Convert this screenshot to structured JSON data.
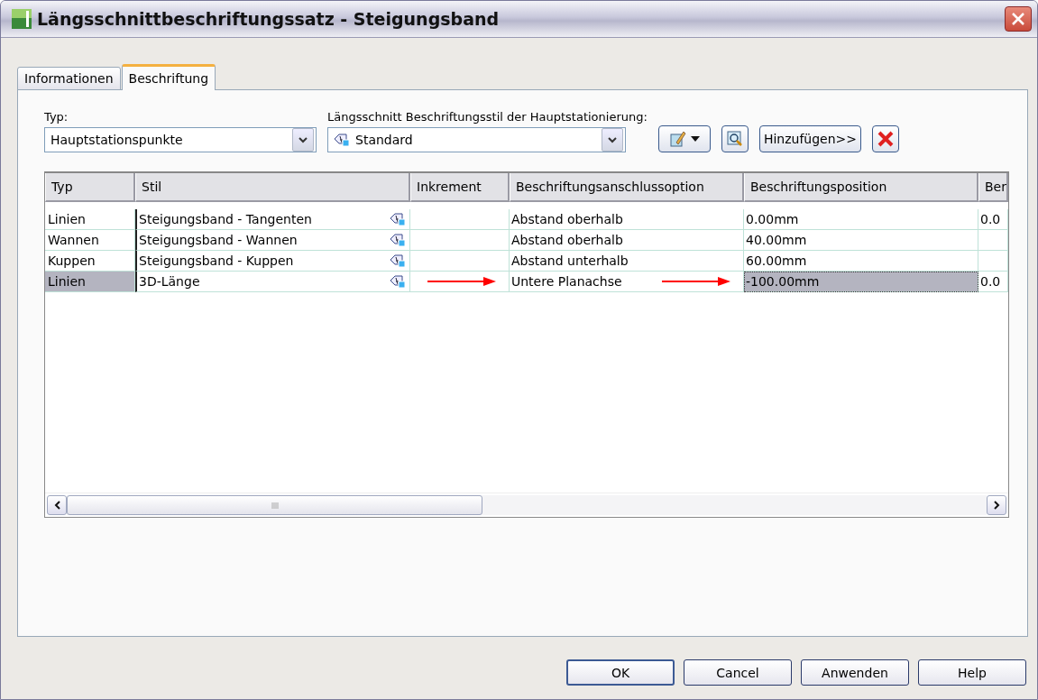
{
  "window": {
    "title": "Längsschnittbeschriftungssatz - Steigungsband"
  },
  "tabs": [
    {
      "label": "Informationen",
      "selected": false
    },
    {
      "label": "Beschriftung",
      "selected": true
    }
  ],
  "type_field": {
    "label": "Typ:",
    "value": "Hauptstationspunkte"
  },
  "style_field": {
    "label": "Längsschnitt Beschriftungsstil der Hauptstationierung:",
    "value": "Standard"
  },
  "add_button": {
    "label": "Hinzufügen>>"
  },
  "table": {
    "columns": [
      {
        "label": "Typ",
        "kind": "text"
      },
      {
        "label": "Stil",
        "kind": "style"
      },
      {
        "label": "Inkrement",
        "kind": "text"
      },
      {
        "label": "Beschriftungsanschlussoption",
        "kind": "text"
      },
      {
        "label": "Beschriftungsposition",
        "kind": "text"
      },
      {
        "label": "Ber",
        "kind": "text"
      }
    ],
    "rows": [
      {
        "selected": false,
        "cells": [
          {
            "text": "Linien",
            "focused": false,
            "arrow": false
          },
          {
            "text": "Steigungsband - Tangenten",
            "focused": false,
            "arrow": false
          },
          {
            "focused": false,
            "arrow": false
          },
          {
            "text": "Abstand oberhalb",
            "focused": false,
            "arrow": false
          },
          {
            "text": "0.00mm",
            "focused": false,
            "arrow": false
          },
          {
            "text": "0.0",
            "focused": false,
            "arrow": false
          }
        ]
      },
      {
        "selected": false,
        "cells": [
          {
            "text": "Wannen",
            "focused": false,
            "arrow": false
          },
          {
            "text": "Steigungsband - Wannen",
            "focused": false,
            "arrow": false
          },
          {
            "focused": false,
            "arrow": false
          },
          {
            "text": "Abstand oberhalb",
            "focused": false,
            "arrow": false
          },
          {
            "text": "40.00mm",
            "focused": false,
            "arrow": false
          },
          {
            "focused": false,
            "arrow": false
          }
        ]
      },
      {
        "selected": false,
        "cells": [
          {
            "text": "Kuppen",
            "focused": false,
            "arrow": false
          },
          {
            "text": "Steigungsband - Kuppen",
            "focused": false,
            "arrow": false
          },
          {
            "focused": false,
            "arrow": false
          },
          {
            "text": "Abstand unterhalb",
            "focused": false,
            "arrow": false
          },
          {
            "text": "60.00mm",
            "focused": false,
            "arrow": false
          },
          {
            "focused": false,
            "arrow": false
          }
        ]
      },
      {
        "selected": true,
        "cells": [
          {
            "text": "Linien",
            "focused": false,
            "arrow": false
          },
          {
            "text": "3D-Länge",
            "focused": false,
            "arrow": false
          },
          {
            "focused": false,
            "arrow": true
          },
          {
            "text": "Untere Planachse",
            "focused": false,
            "arrow": true
          },
          {
            "text": "-100.00mm",
            "focused": true,
            "arrow": false
          },
          {
            "text": "0.0",
            "focused": false,
            "arrow": false
          }
        ]
      }
    ]
  },
  "buttons": [
    {
      "label": "OK",
      "default": true
    },
    {
      "label": "Cancel",
      "default": false
    },
    {
      "label": "Anwenden",
      "default": false
    },
    {
      "label": "Help",
      "default": false
    }
  ]
}
